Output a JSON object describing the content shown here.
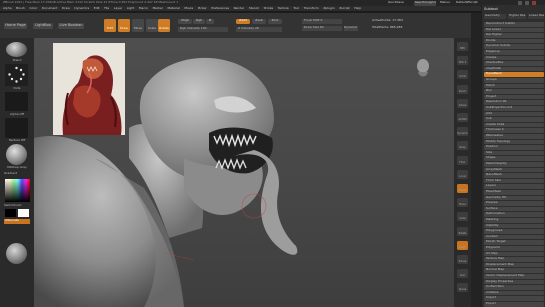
{
  "titlebar": {
    "text": "ZBrush 2021 | Free Mem 17.076GB  Active Mem 2132  Scratch Disk 41  ZTime 0.952  PolyCount 2.497 KP  MeshCount 1",
    "right": [
      "QuickSave",
      "See-through 0",
      "Menus",
      "DefaultZScript"
    ]
  },
  "menubar": {
    "items": [
      "Alpha",
      "Brush",
      "Color",
      "Document",
      "Draw",
      "Dynamics",
      "Edit",
      "File",
      "Layer",
      "Light",
      "Macro",
      "Marker",
      "Material",
      "Movie",
      "Picker",
      "Preferences",
      "Render",
      "Stencil",
      "Stroke",
      "Texture",
      "Tool",
      "Transform",
      "Zplugin",
      "Zscript",
      "Help"
    ]
  },
  "shelf": {
    "home": "Home Page",
    "lightbox": "LightBox",
    "live_boolean": "Live Boolean",
    "edit": "Edit",
    "draw": "Draw",
    "move": "Move",
    "scale": "Scale",
    "rotate": "Rotate",
    "mrgb": "Mrgb",
    "rgb": "Rgb",
    "m": "M",
    "zadd": "Zadd",
    "zsub": "Zsub",
    "zcut": "Zcut",
    "focal_shift": "Focal Shift 0",
    "draw_size": "Draw Size 64",
    "z_intensity": "Z Intensity 26",
    "rgb_intensity": "Rgb Intensity 100",
    "active_points": "ActivePoints: 17,384",
    "total_points": "TotalPoints: 865,963",
    "dynamic": "Dynamic"
  },
  "left_tray": {
    "brush": "Stand",
    "stroke": "Dots",
    "alpha": "Alpha Off",
    "texture": "Texture Off",
    "material": "MatCap Gray",
    "gradient": "Gradient",
    "switch_color": "SwitchColor",
    "alternate": "Alternate"
  },
  "palette": {
    "header": "Subtool",
    "tabs": [
      "Geometry",
      "Higher Res",
      "Lower Res"
    ],
    "rows": [
      "Reconstruct Subdiv",
      "Del Lower",
      "Del Higher",
      "Divide",
      "Dynamic Subdiv",
      "Edgeloop",
      "Crease",
      "ShadowBox",
      "ClayPolish",
      "DynaMesh",
      "Groups",
      "Polish",
      "Blur",
      "Project",
      "Resolution 96",
      "SubProjection 0.6",
      "Add",
      "Sub",
      "Create Shell",
      "Thickness 4",
      "ZRemesher",
      "Modify Topology",
      "Position",
      "Size",
      "Shape",
      "MeshIntegrity",
      "ArrayMesh",
      "NanoMesh",
      "Thick Skin",
      "Layers",
      "FiberMesh",
      "Geometry HD",
      "Preview",
      "Surface",
      "Deformation",
      "Masking",
      "Visibility",
      "Polygroups",
      "Contact",
      "Morph Target",
      "Polypaint",
      "UV Map",
      "Texture Map",
      "Displacement Map",
      "Normal Map",
      "Vector Displacement Map",
      "Display Properties",
      "Unified Skin",
      "Initialize",
      "Import",
      "Export"
    ],
    "orange_rows": [
      "DynaMesh"
    ]
  },
  "right_shelf": {
    "buttons": [
      "BPR",
      "SPix 3",
      "Scroll",
      "Zoom",
      "Actual",
      "AAHalf",
      "Dynamic",
      "Persp",
      "Floor",
      "Local",
      "Frame",
      "Move",
      "Scale",
      "Rotate",
      "PolyF",
      "Transp",
      "Solo",
      "Xpose"
    ],
    "orange_indices": [
      10,
      14
    ]
  },
  "reference": {
    "label": "Reference"
  },
  "colors": {
    "accent": "#d07c24",
    "panel": "#2e2e2e",
    "viewport": "#4a4a4a"
  }
}
